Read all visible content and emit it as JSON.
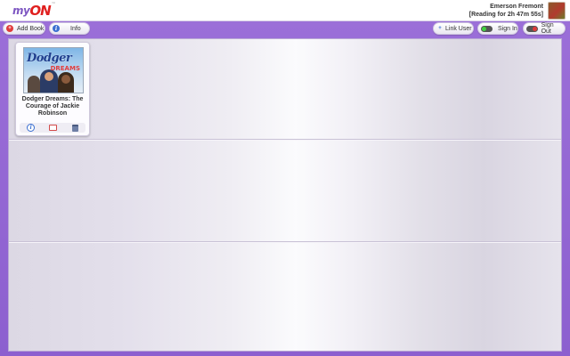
{
  "header": {
    "logo_my": "my",
    "logo_on": "ON",
    "logo_tm": "™",
    "user_name": "Emerson Fremont",
    "reading_status": "[Reading for 2h 47m 55s]"
  },
  "toolbar": {
    "add_book_label": "Add Book",
    "add_icon": "+",
    "info_label": "Info",
    "info_icon": "i",
    "link_user_label": "Link User",
    "link_icon": "+",
    "sign_in_label": "Sign In",
    "sign_out_label": "Sign Out"
  },
  "shelf": {
    "books": [
      {
        "cover_title": "Dodger",
        "cover_subtitle": "DREAMS",
        "title": "Dodger Dreams: The Courage of Jackie Robinson",
        "info_icon": "i"
      }
    ]
  },
  "colors": {
    "frame_purple": "#8c5fcf",
    "logo_red": "#e0201f",
    "logo_purple": "#7e57c2",
    "sign_in_green": "#3fd13f",
    "sign_out_red": "#e03b3b"
  }
}
